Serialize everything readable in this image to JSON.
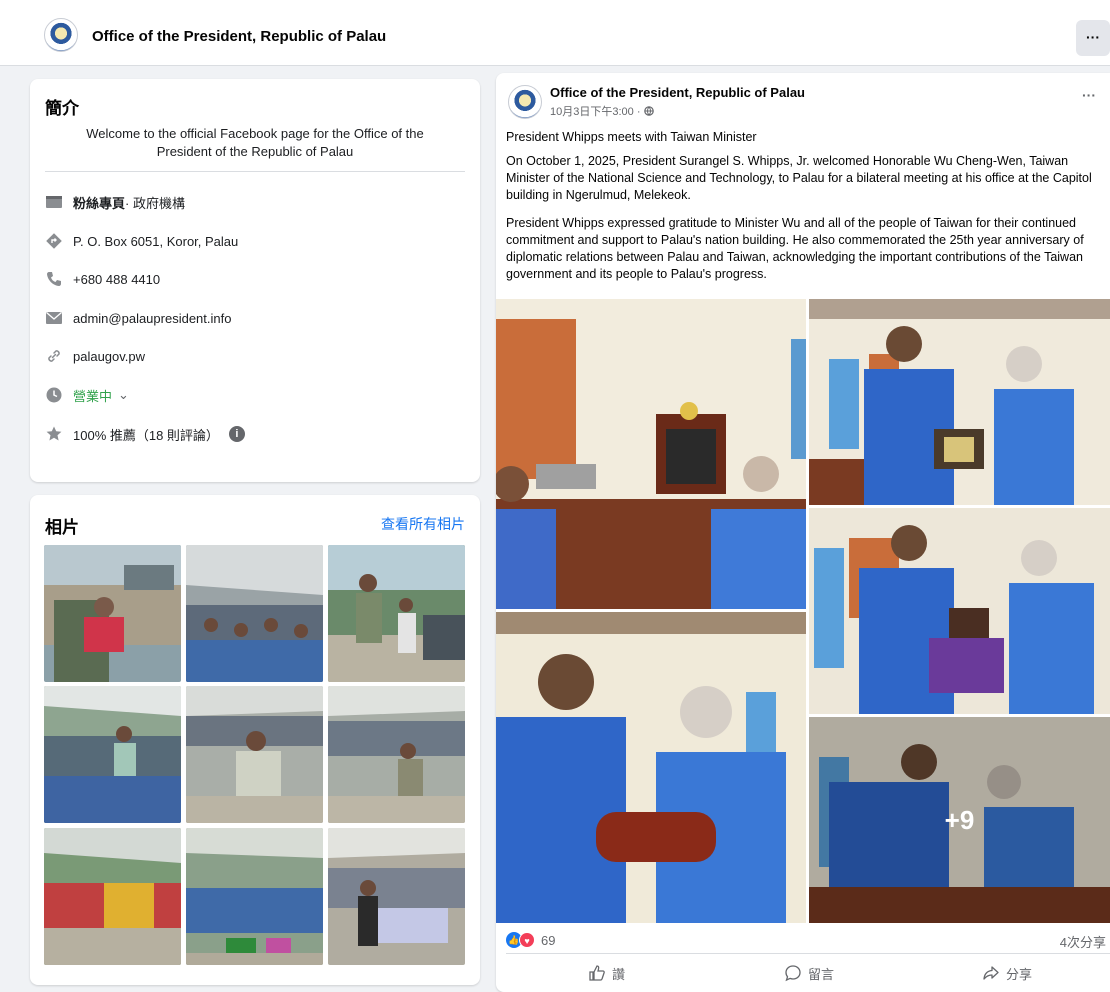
{
  "header": {
    "page_name": "Office of the President, Republic of Palau",
    "more_label": "···"
  },
  "intro": {
    "title": "簡介",
    "description": "Welcome to the official Facebook page for the Office of the President of the Republic of Palau",
    "category_label": "粉絲專頁",
    "category_value": " · 政府機構",
    "address": "P. O. Box 6051, Koror, Palau",
    "phone": "+680 488 4410",
    "email": "admin@palaupresident.info",
    "website": "palaugov.pw",
    "hours_status": "營業中",
    "hours_chevron": "⌄",
    "rating": "100% 推薦（18 則評論）",
    "info_icon": "i"
  },
  "photos": {
    "title": "相片",
    "see_all": "查看所有相片"
  },
  "post": {
    "author": "Office of the President, Republic of Palau",
    "timestamp": "10月3日下午3:00 · ",
    "more_label": "···",
    "headline": "President Whipps meets with Taiwan Minister",
    "paragraph1": "On October 1, 2025, President Surangel S. Whipps, Jr. welcomed Honorable Wu Cheng-Wen, Taiwan Minister of the National Science and Technology, to Palau for a bilateral meeting at his office at the Capitol building in Ngerulmud, Melekeok.",
    "paragraph2": "President Whipps expressed gratitude to Minister Wu and all of the people of Taiwan for their continued commitment and support to Palau's nation building.  He also commemorated the 25th year anniversary of diplomatic relations between Palau and Taiwan, acknowledging the important contributions of the Taiwan government and its people to Palau's progress.",
    "more_photos": "+9",
    "reaction_count": "69",
    "share_count": "4次分享",
    "actions": {
      "like": "讚",
      "comment": "留言",
      "share": "分享"
    }
  },
  "colors": {
    "accent": "#1877f2",
    "open_green": "#31a24c",
    "background": "#f0f2f5"
  }
}
